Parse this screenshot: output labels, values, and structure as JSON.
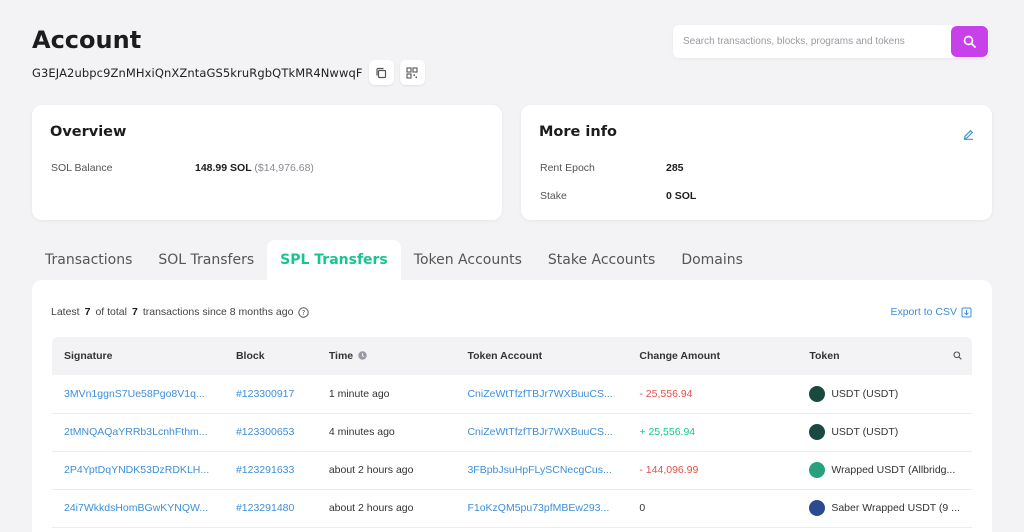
{
  "header": {
    "title": "Account",
    "address": "G3EJA2ubpc9ZnMHxiQnXZntaGS5kruRgbQTkMR4NwwqF"
  },
  "search": {
    "placeholder": "Search transactions, blocks, programs and tokens"
  },
  "overview": {
    "title": "Overview",
    "sol_balance_label": "SOL Balance",
    "sol_balance_value": "148.99 SOL",
    "sol_balance_usd": "($14,976.68)"
  },
  "more_info": {
    "title": "More info",
    "rent_epoch_label": "Rent Epoch",
    "rent_epoch_value": "285",
    "stake_label": "Stake",
    "stake_value": "0 SOL"
  },
  "tabs": [
    {
      "label": "Transactions"
    },
    {
      "label": "SOL Transfers"
    },
    {
      "label": "SPL Transfers"
    },
    {
      "label": "Token Accounts"
    },
    {
      "label": "Stake Accounts"
    },
    {
      "label": "Domains"
    }
  ],
  "active_tab": "SPL Transfers",
  "summary": {
    "prefix": "Latest",
    "latest": "7",
    "middle": "of total",
    "total": "7",
    "suffix": "transactions since 8 months ago"
  },
  "export_label": "Export to CSV",
  "table": {
    "headers": [
      "Signature",
      "Block",
      "Time",
      "Token Account",
      "Change Amount",
      "Token"
    ],
    "rows": [
      {
        "signature": "3MVn1ggnS7Ue58Pgo8V1q...",
        "block": "#123300917",
        "time": "1 minute ago",
        "token_account": "CniZeWtTfzfTBJr7WXBuuCS...",
        "change": "- 25,556.94",
        "direction": "neg",
        "token": "USDT (USDT)",
        "icon_color": "#1a4a3f"
      },
      {
        "signature": "2tMNQAQaYRRb3LcnhFthm...",
        "block": "#123300653",
        "time": "4 minutes ago",
        "token_account": "CniZeWtTfzfTBJr7WXBuuCS...",
        "change": "+ 25,556.94",
        "direction": "pos",
        "token": "USDT (USDT)",
        "icon_color": "#1a4a3f"
      },
      {
        "signature": "2P4YptDqYNDK53DzRDKLH...",
        "block": "#123291633",
        "time": "about 2 hours ago",
        "token_account": "3FBpbJsuHpFLySCNecgCus...",
        "change": "- 144,096.99",
        "direction": "neg",
        "token": "Wrapped USDT (Allbridg...",
        "icon_color": "#26a17b"
      },
      {
        "signature": "24i7WkkdsHomBGwKYNQW...",
        "block": "#123291480",
        "time": "about 2 hours ago",
        "token_account": "F1oKzQM5pu73pfMBEw293...",
        "change": "0",
        "direction": "none",
        "token": "Saber Wrapped USDT (9 ...",
        "icon_color": "#2b4a8f"
      }
    ]
  },
  "colors": {
    "accent": "#19c58f",
    "search_button": "#c840e9",
    "link": "#3e8ed8",
    "negative": "#e0504a"
  }
}
